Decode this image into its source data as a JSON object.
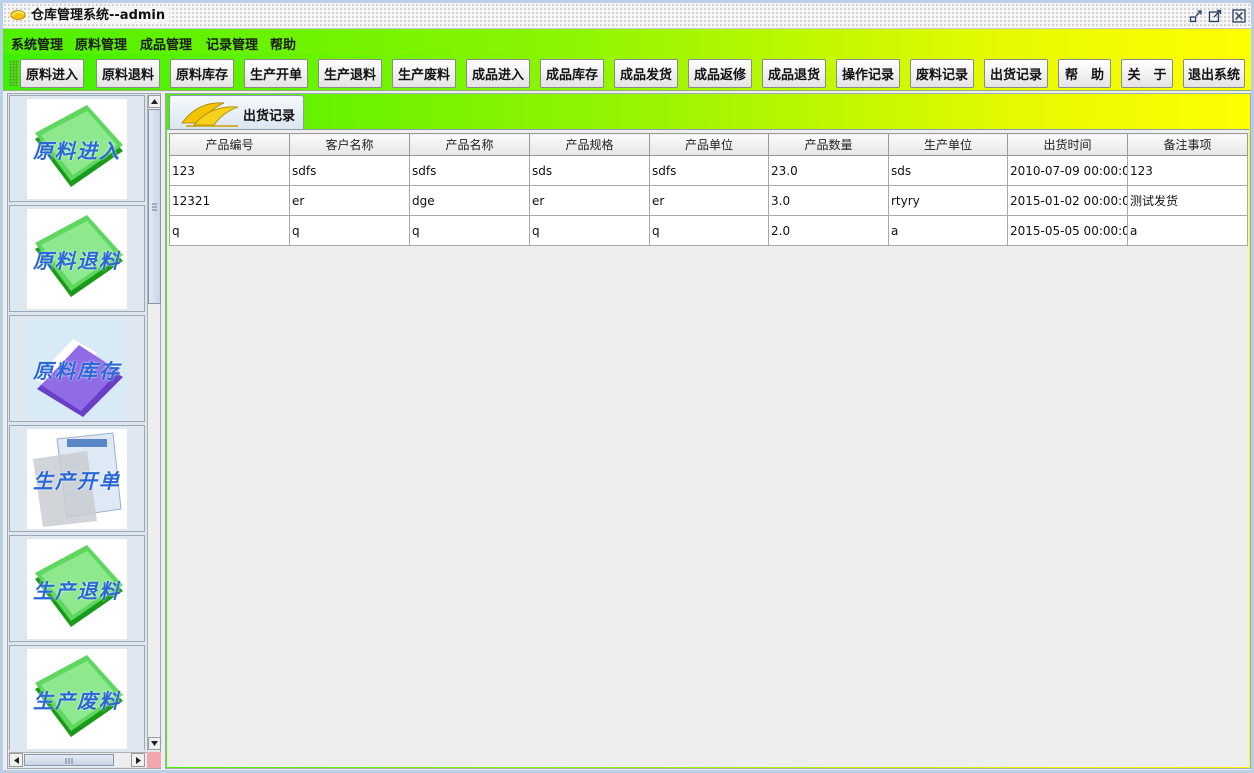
{
  "window": {
    "title": "仓库管理系统--admin"
  },
  "menubar": {
    "items": [
      "系统管理",
      "原料管理",
      "成品管理",
      "记录管理",
      "帮助"
    ]
  },
  "toolbar": {
    "buttons": [
      "原料进入",
      "原料退料",
      "原料库存",
      "生产开单",
      "生产退料",
      "生产废料",
      "成品进入",
      "成品库存",
      "成品发货",
      "成品返修",
      "成品退货",
      "操作记录",
      "废料记录",
      "出货记录",
      "帮　助",
      "关　于",
      "退出系统"
    ]
  },
  "sidebar": {
    "items": [
      {
        "label": "原料进入",
        "icon": "green-book-icon"
      },
      {
        "label": "原料退料",
        "icon": "green-book-icon"
      },
      {
        "label": "原料库存",
        "icon": "purple-folder-icon"
      },
      {
        "label": "生产开单",
        "icon": "document-icon"
      },
      {
        "label": "生产退料",
        "icon": "green-book-icon"
      },
      {
        "label": "生产废料",
        "icon": "green-book-icon"
      }
    ]
  },
  "tab": {
    "label": "出货记录",
    "icon": "bananas-icon"
  },
  "table": {
    "columns": [
      "产品编号",
      "客户名称",
      "产品名称",
      "产品规格",
      "产品单位",
      "产品数量",
      "生产单位",
      "出货时间",
      "备注事项"
    ],
    "rows": [
      [
        "123",
        "sdfs",
        "sdfs",
        "sds",
        "sdfs",
        "23.0",
        "sds",
        "2010-07-09 00:00:0...",
        "123"
      ],
      [
        "12321",
        "er",
        "dge",
        "er",
        "er",
        "3.0",
        "rtyry",
        "2015-01-02 00:00:0...",
        "测试发货"
      ],
      [
        "q",
        "q",
        "q",
        "q",
        "q",
        "2.0",
        "a",
        "2015-05-05 00:00:0...",
        "a"
      ]
    ]
  },
  "colors": {
    "toolbar_gradient_start": "#3cf000",
    "toolbar_gradient_end": "#ffff00",
    "sidebar_label": "#2a68d8",
    "scroll_corner": "#f2a6b0"
  }
}
